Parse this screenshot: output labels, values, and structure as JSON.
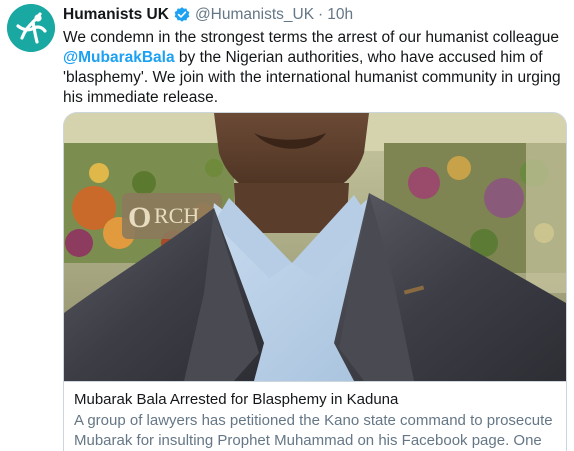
{
  "tweet": {
    "avatar_icon": "humanist-happy-human-icon",
    "avatar_color": "#1aa8a3",
    "display_name": "Humanists UK",
    "verified_icon": "verified-badge-icon",
    "verified_color": "#1da1f2",
    "handle": "@Humanists_UK",
    "separator": "·",
    "timestamp": "10h",
    "text_parts": {
      "part1": "We condemn in the strongest terms the arrest of our humanist colleague ",
      "mention": "@MubarakBala",
      "part2": " by the Nigerian authorities, who have accused him of 'blasphemy'. We join with the international humanist community in urging his immediate release."
    },
    "mention_color": "#1da1f2"
  },
  "card": {
    "image_description_icon": "link-preview-photo",
    "title": "Mubarak Bala Arrested for Blasphemy in Kaduna",
    "description": "A group of lawyers has petitioned the Kano state command to prosecute Mubarak for insulting Prophet Muhammad on his Facebook page. One ..."
  }
}
